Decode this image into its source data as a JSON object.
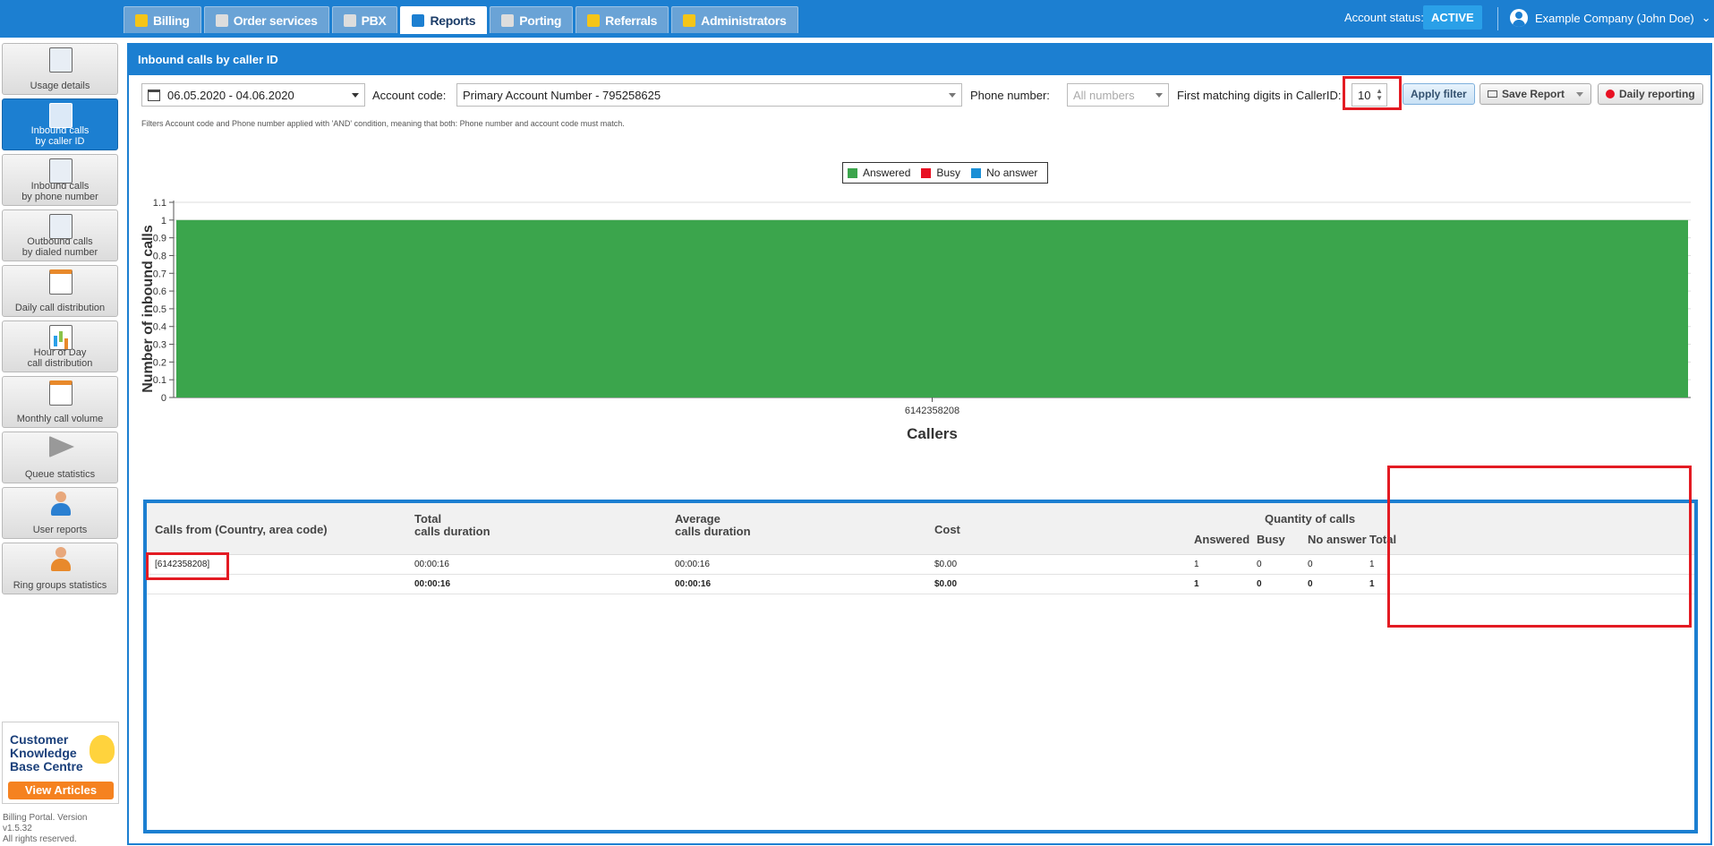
{
  "nav": {
    "tabs": [
      {
        "label": "Billing",
        "icon": "coins-icon",
        "color": "#f5c518"
      },
      {
        "label": "Order services",
        "icon": "cart-icon",
        "color": "#dddddd"
      },
      {
        "label": "PBX",
        "icon": "pbx-icon",
        "color": "#dddddd"
      },
      {
        "label": "Reports",
        "icon": "report-icon",
        "color": "#1c7fd1"
      },
      {
        "label": "Porting",
        "icon": "porting-icon",
        "color": "#dddddd"
      },
      {
        "label": "Referrals",
        "icon": "referrals-icon",
        "color": "#f5c518"
      },
      {
        "label": "Administrators",
        "icon": "admin-icon",
        "color": "#f5c518"
      }
    ],
    "active_tab": "Reports"
  },
  "account": {
    "status_label": "Account status:",
    "status": "ACTIVE",
    "user": "Example Company (John Doe)"
  },
  "sidebar": {
    "items": [
      {
        "label1": "Usage details",
        "label2": "",
        "icon": "notepad-icon"
      },
      {
        "label1": "Inbound calls",
        "label2": "by caller ID",
        "icon": "phone-inbound-icon"
      },
      {
        "label1": "Inbound calls",
        "label2": "by phone number",
        "icon": "phone-icon"
      },
      {
        "label1": "Outbound calls",
        "label2": "by dialed number",
        "icon": "phone-outbound-icon"
      },
      {
        "label1": "Daily call distribution",
        "label2": "",
        "icon": "calendar-day-icon"
      },
      {
        "label1": "Hour of Day",
        "label2": "call distribution",
        "icon": "bar-chart-icon"
      },
      {
        "label1": "Monthly call volume",
        "label2": "",
        "icon": "calendar-month-icon"
      },
      {
        "label1": "Queue statistics",
        "label2": "",
        "icon": "megaphone-icon"
      },
      {
        "label1": "User reports",
        "label2": "",
        "icon": "user-icon"
      },
      {
        "label1": "Ring groups statistics",
        "label2": "",
        "icon": "ring-group-icon"
      }
    ],
    "active_index": 1,
    "kb": {
      "line1": "Customer",
      "line2": "Knowledge",
      "line3": "Base Centre",
      "button": "View Articles"
    },
    "version": {
      "line1": "Billing Portal. Version",
      "line2": "v1.5.32",
      "line3": "All rights reserved."
    }
  },
  "panel": {
    "title": "Inbound calls by caller ID",
    "filters": {
      "date_range": "06.05.2020 - 04.06.2020",
      "account_code_label": "Account code:",
      "account_code_value": "Primary Account Number - 795258625",
      "phone_number_label": "Phone number:",
      "phone_number_placeholder": "All numbers",
      "digits_label": "First matching digits in CallerID:",
      "digits_value": "10",
      "apply": "Apply filter",
      "save": "Save Report",
      "daily": "Daily reporting"
    },
    "note": "Filters Account code and Phone number applied with 'AND' condition, meaning that both: Phone number and account code must match."
  },
  "chart_data": {
    "type": "bar",
    "categories": [
      "6142358208"
    ],
    "series": [
      {
        "name": "Answered",
        "values": [
          1
        ],
        "color": "#3ba54c"
      },
      {
        "name": "Busy",
        "values": [
          0
        ],
        "color": "#e81123"
      },
      {
        "name": "No answer",
        "values": [
          0
        ],
        "color": "#1a8fd6"
      }
    ],
    "stacked": true,
    "xlabel": "Callers",
    "ylabel": "Number of inbound calls",
    "ylim": [
      0,
      1.1
    ],
    "yticks": [
      "0",
      "0.1",
      "0.2",
      "0.3",
      "0.4",
      "0.5",
      "0.6",
      "0.7",
      "0.8",
      "0.9",
      "1",
      "1.1"
    ],
    "grid": true,
    "legend": "top-center"
  },
  "table": {
    "headers": {
      "from": "Calls from (Country, area code)",
      "total1": "Total",
      "total2": "calls duration",
      "avg1": "Average",
      "avg2": "calls duration",
      "cost": "Cost",
      "qty": "Quantity of calls",
      "answered": "Answered",
      "busy": "Busy",
      "noanswer": "No answer",
      "total": "Total"
    },
    "rows": [
      {
        "from": "[6142358208]",
        "total": "00:00:16",
        "avg": "00:00:16",
        "cost": "$0.00",
        "answered": "1",
        "busy": "0",
        "noanswer": "0",
        "count": "1"
      }
    ],
    "totals": {
      "from": "",
      "total": "00:00:16",
      "avg": "00:00:16",
      "cost": "$0.00",
      "answered": "1",
      "busy": "0",
      "noanswer": "0",
      "count": "1"
    }
  }
}
